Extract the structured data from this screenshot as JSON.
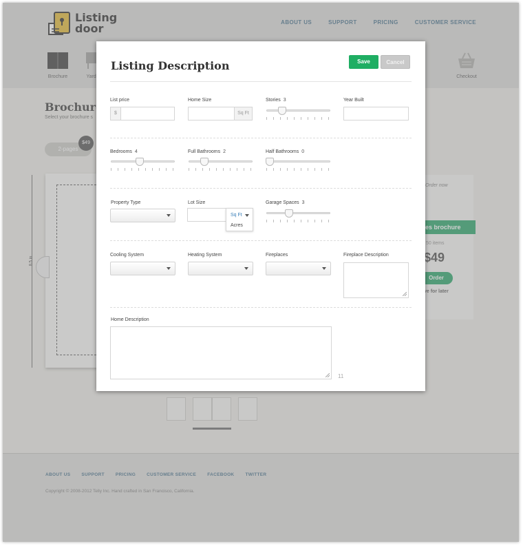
{
  "header": {
    "logo_line1": "Listing",
    "logo_line2": "door",
    "nav": [
      "ABOUT US",
      "SUPPORT",
      "PRICING",
      "CUSTOMER SERVICE"
    ],
    "steps": [
      {
        "label": "Brochure",
        "icon": "brochure-icon"
      },
      {
        "label": "Yard S",
        "icon": "yard-sign-icon"
      },
      {
        "label": "Checkout",
        "icon": "basket-icon"
      }
    ]
  },
  "page": {
    "title": "Brochure",
    "subtitle": "Select your brochure s",
    "pill": "2-pages",
    "badge": "$49",
    "ruler_label": "8.5 in"
  },
  "order": {
    "order_now": "Order now",
    "ribbon": "es brochure",
    "items": "50 items",
    "price": "$49",
    "button": "Order",
    "later": "ve for later"
  },
  "footer": {
    "links": [
      "ABOUT US",
      "SUPPORT",
      "PRICING",
      "CUSTOMER SERVICE",
      "FACEBOOK",
      "TWITTER"
    ],
    "copyright": "Copyright © 2008-2012 Telly Inc. Hand crafted in San Francisco, California."
  },
  "modal": {
    "title": "Listing Description",
    "save": "Save",
    "cancel": "Cancel",
    "list_price": {
      "label": "List price",
      "prefix": "$",
      "value": ""
    },
    "home_size": {
      "label": "Home Size",
      "suffix": "Sq Ft",
      "value": ""
    },
    "stories": {
      "label": "Stories",
      "value": 3,
      "level": 0.25
    },
    "year_built": {
      "label": "Year Built",
      "value": ""
    },
    "bedrooms": {
      "label": "Bedrooms",
      "value": 4,
      "level": 0.45
    },
    "full_bathrooms": {
      "label": "Full Bathrooms",
      "value": 2,
      "level": 0.25
    },
    "half_bathrooms": {
      "label": "Half Bathrooms",
      "value": 0,
      "level": 0.05
    },
    "property_type": {
      "label": "Property Type",
      "value": ""
    },
    "lot_size": {
      "label": "Lot Size",
      "value": "",
      "unit_selected": "Sq Ft",
      "unit_options": [
        "Sq Ft",
        "Acres"
      ]
    },
    "garage_spaces": {
      "label": "Garage Spaces",
      "value": 3,
      "level": 0.35
    },
    "cooling_system": {
      "label": "Cooling System",
      "value": ""
    },
    "heating_system": {
      "label": "Heating System",
      "value": ""
    },
    "fireplaces": {
      "label": "Fireplaces",
      "value": ""
    },
    "fireplace_description": {
      "label": "Fireplace Description",
      "value": ""
    },
    "home_description": {
      "label": "Home Description",
      "value": "",
      "char_count": "11"
    }
  },
  "colors": {
    "accent": "#1fae63",
    "link": "#3f6a86"
  }
}
